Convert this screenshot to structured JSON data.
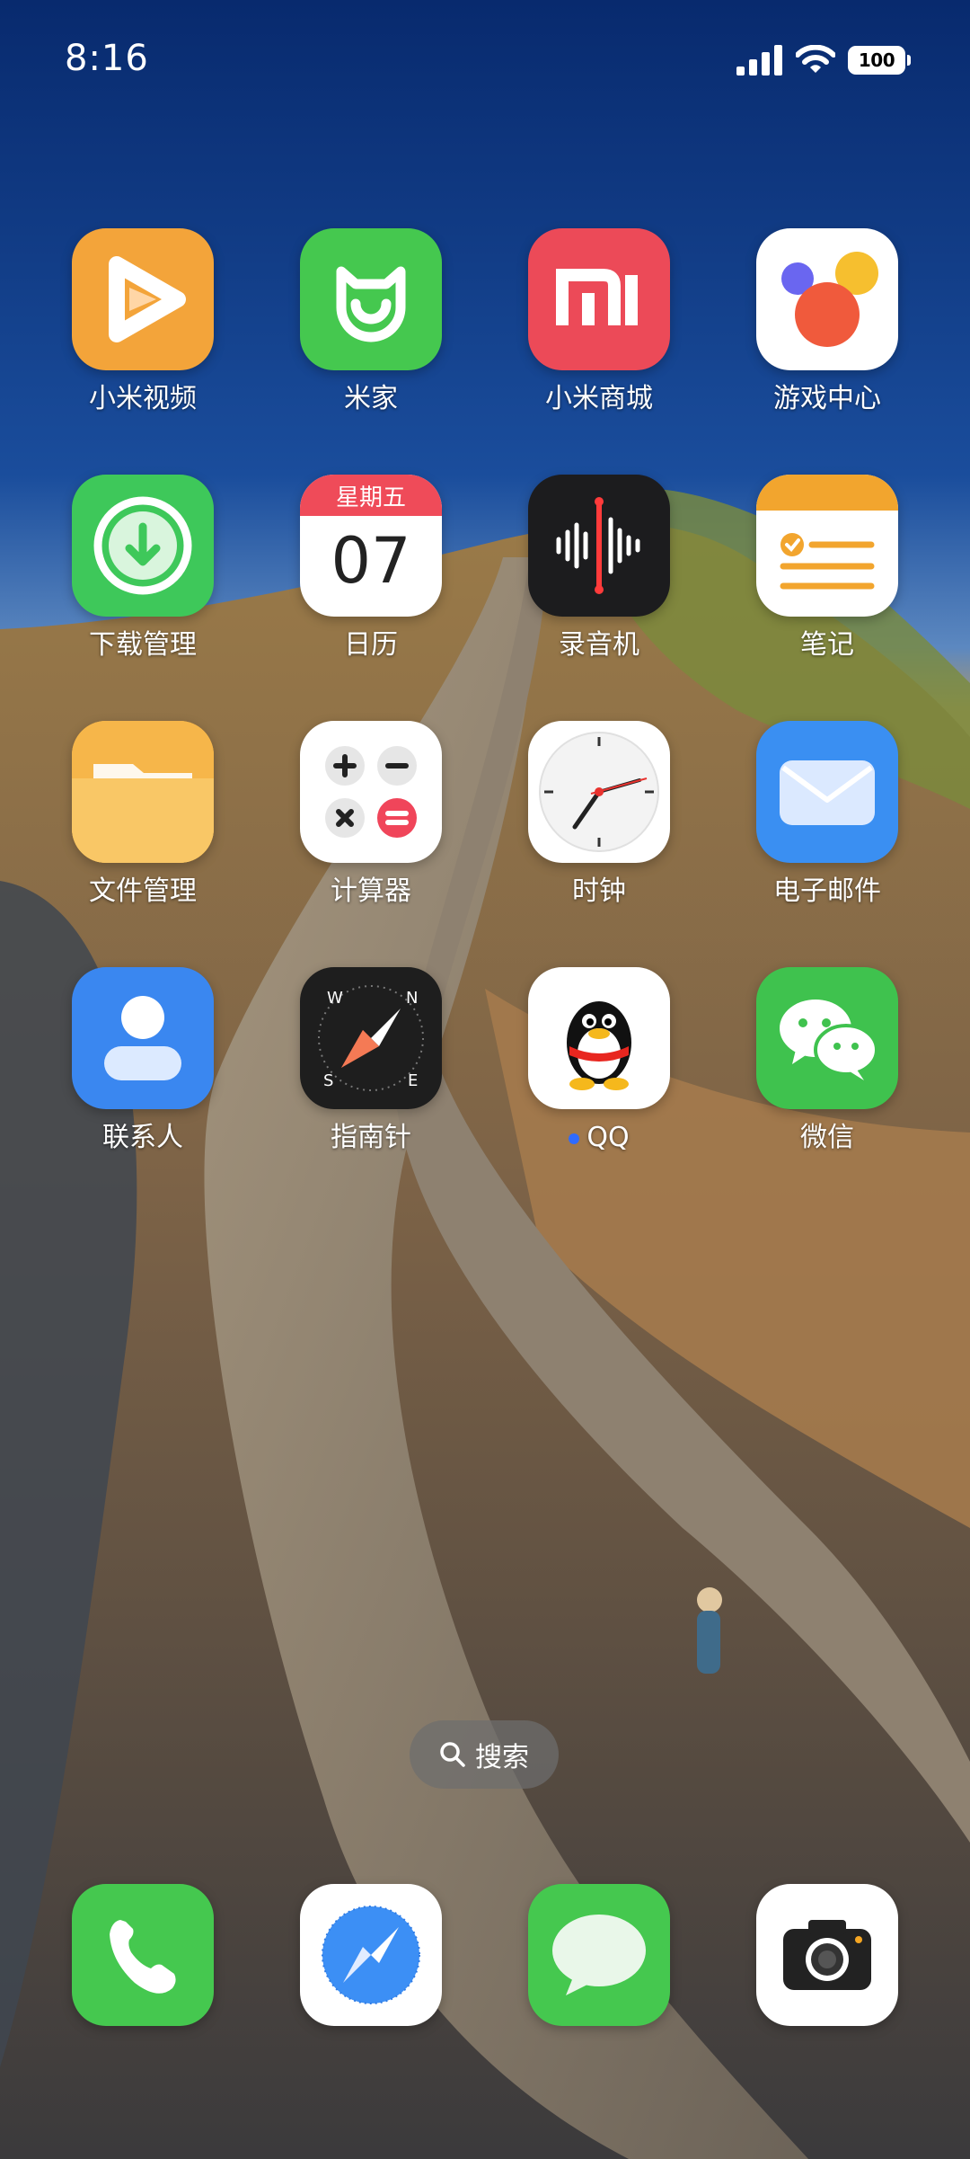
{
  "status_bar": {
    "time": "8:16",
    "battery": "100",
    "signal_icon": "cellular-signal-icon",
    "wifi_icon": "wifi-icon"
  },
  "apps": {
    "mi_video": {
      "label": "小米视频",
      "icon": "mi-video-icon",
      "color": "#f3a43a"
    },
    "mi_home": {
      "label": "米家",
      "icon": "mi-home-icon",
      "color": "#45c84f"
    },
    "mi_store": {
      "label": "小米商城",
      "icon": "mi-store-icon",
      "color": "#ec4a58"
    },
    "game_center": {
      "label": "游戏中心",
      "icon": "game-center-icon",
      "color": "#ffffff"
    },
    "downloads": {
      "label": "下载管理",
      "icon": "download-icon",
      "color": "#3ec85a"
    },
    "calendar": {
      "label": "日历",
      "icon": "calendar-icon",
      "weekday": "星期五",
      "day": "07"
    },
    "recorder": {
      "label": "录音机",
      "icon": "recorder-icon",
      "color": "#1c1c1e"
    },
    "notes": {
      "label": "笔记",
      "icon": "notes-icon",
      "color": "#f2a52e"
    },
    "file_manager": {
      "label": "文件管理",
      "icon": "folder-icon",
      "color": "#f6b64a"
    },
    "calculator": {
      "label": "计算器",
      "icon": "calculator-icon",
      "color": "#ffffff"
    },
    "clock": {
      "label": "时钟",
      "icon": "clock-icon",
      "color": "#ffffff"
    },
    "email": {
      "label": "电子邮件",
      "icon": "mail-icon",
      "color": "#3a8ff2"
    },
    "contacts": {
      "label": "联系人",
      "icon": "contacts-icon",
      "color": "#3a87f0"
    },
    "compass": {
      "label": "指南针",
      "icon": "compass-icon",
      "color": "#1e1e1e"
    },
    "qq": {
      "label": "QQ",
      "icon": "qq-penguin-icon",
      "color": "#ffffff",
      "new_indicator": true
    },
    "wechat": {
      "label": "微信",
      "icon": "wechat-icon",
      "color": "#3fc24e"
    }
  },
  "search": {
    "label": "搜索",
    "icon": "search-icon"
  },
  "dock": {
    "phone": {
      "icon": "phone-icon",
      "color": "#45c84f"
    },
    "browser": {
      "icon": "browser-compass-icon",
      "color": "#ffffff"
    },
    "messages": {
      "icon": "messages-icon",
      "color": "#45c84f"
    },
    "camera": {
      "icon": "camera-icon",
      "color": "#ffffff"
    }
  }
}
